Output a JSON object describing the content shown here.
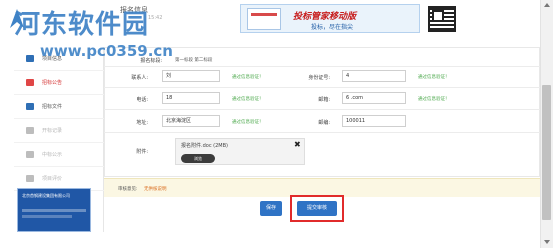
{
  "watermark": {
    "title": "河东软件园",
    "url": "www.pc0359.cn"
  },
  "header": {
    "title": "报名信息",
    "time": "15:42"
  },
  "ad": {
    "title": "投标管家移动版",
    "subtitle": "投标，尽在指尖"
  },
  "sidebar": {
    "items": [
      {
        "label": "项目信息",
        "state": "normal"
      },
      {
        "label": "招标公告",
        "state": "active"
      },
      {
        "label": "招标文件",
        "state": "normal"
      },
      {
        "label": "开标记录",
        "state": "disabled"
      },
      {
        "label": "中标公示",
        "state": "disabled"
      },
      {
        "label": "项目评价",
        "state": "disabled"
      }
    ],
    "banner": {
      "line1": "北京首钢建设集团有限公司",
      "line2": ""
    }
  },
  "form": {
    "section_label": "报名标段:",
    "section_value": "第一标段 第二标段",
    "contact_label": "联系人:",
    "contact_value": "刘",
    "contact_note": "通过信息验证！",
    "id_label": "身份证号:",
    "id_value": "4",
    "id_note": "通过信息验证！",
    "phone_label": "电话:",
    "phone_value": "18",
    "phone_note": "通过信息验证！",
    "email_label": "邮箱:",
    "email_value": "6                        .com",
    "email_note": "通过信息验证！",
    "address_label": "地址:",
    "address_value": "北京海淀区",
    "address_note": "通过信息验证！",
    "zip_label": "邮编:",
    "zip_value": "100011",
    "attach_label": "附件:",
    "file_name": "报名附件.doc (2MB)",
    "file_remove": "✖",
    "browse_label": "浏览"
  },
  "review": {
    "label": "审核意见:",
    "value": "无供核说明"
  },
  "buttons": {
    "save": "保存",
    "submit": "提交审核"
  },
  "colors": {
    "primary": "#2f73c5",
    "highlight": "#e12b2b",
    "note_green": "#4aa84a",
    "watermark_blue": "#3e82c6"
  }
}
